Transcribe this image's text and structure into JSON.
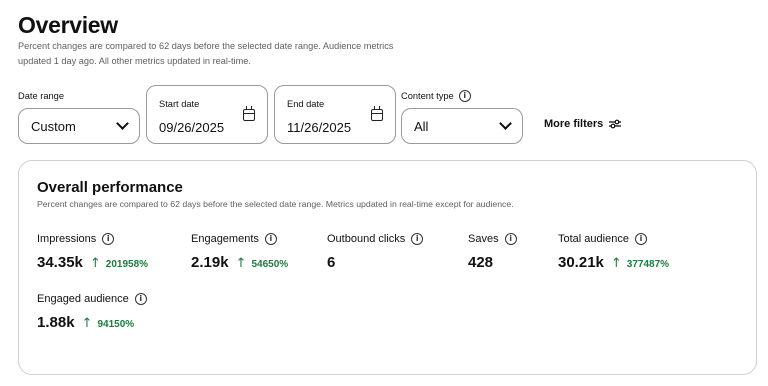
{
  "header": {
    "title": "Overview",
    "subtitle": "Percent changes are compared to 62 days before the selected date range. Audience metrics updated 1 day ago. All other metrics updated in real-time."
  },
  "filters": {
    "date_range": {
      "label": "Date range",
      "value": "Custom"
    },
    "start_date": {
      "label": "Start date",
      "value": "09/26/2025"
    },
    "end_date": {
      "label": "End date",
      "value": "11/26/2025"
    },
    "content_type": {
      "label": "Content type",
      "value": "All"
    },
    "more_filters_label": "More filters"
  },
  "performance": {
    "title": "Overall performance",
    "subtitle": "Percent changes are compared to 62 days before the selected date range. Metrics updated in real-time except for audience.",
    "metrics": [
      {
        "label": "Impressions",
        "value": "34.35k",
        "change": "201958%"
      },
      {
        "label": "Engagements",
        "value": "2.19k",
        "change": "54650%"
      },
      {
        "label": "Outbound clicks",
        "value": "6",
        "change": ""
      },
      {
        "label": "Saves",
        "value": "428",
        "change": ""
      },
      {
        "label": "Total audience",
        "value": "30.21k",
        "change": "377487%"
      },
      {
        "label": "Engaged audience",
        "value": "1.88k",
        "change": "94150%"
      }
    ]
  },
  "icons": {
    "info": "info-icon",
    "calendar": "calendar-icon",
    "chevron": "chevron-down-icon",
    "filter": "filter-sliders-icon",
    "trend": "arrow-up-icon"
  },
  "colors": {
    "positive_change": "#1e7a3e",
    "border": "#9a9a9a"
  }
}
